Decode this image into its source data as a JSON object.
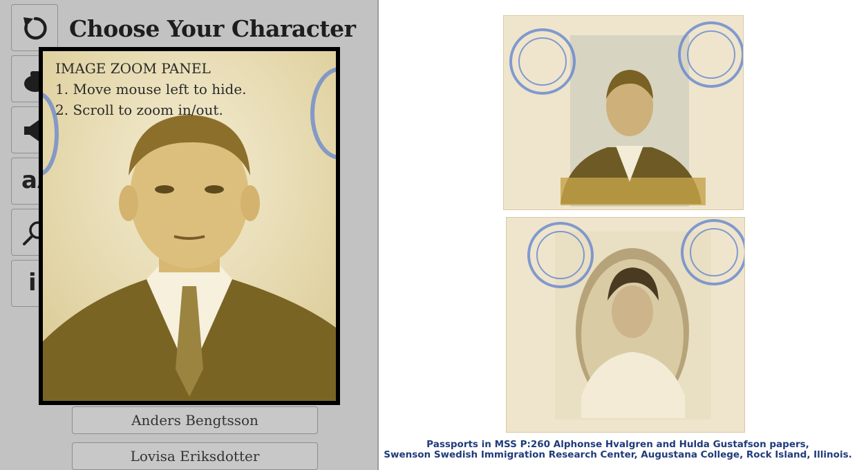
{
  "header": {
    "title": "Choose Your Character"
  },
  "toolbar": {
    "buttons": [
      {
        "name": "restart",
        "icon": "restart-icon"
      },
      {
        "name": "inventory",
        "icon": "bag-icon"
      },
      {
        "name": "sound",
        "icon": "speaker-icon"
      },
      {
        "name": "text-size",
        "icon": "text-size-icon",
        "glyph": "aA"
      },
      {
        "name": "zoom",
        "icon": "magnifier-icon"
      },
      {
        "name": "info",
        "icon": "info-icon",
        "glyph": "i"
      }
    ]
  },
  "zoom_panel": {
    "title": "IMAGE ZOOM PANEL",
    "line1": "1. Move mouse left to hide.",
    "line2": "2. Scroll to zoom in/out."
  },
  "characters": [
    {
      "label": "Anders Bengtsson"
    },
    {
      "label": "Lovisa Eriksdotter"
    }
  ],
  "document": {
    "caption_line1": "Passports in MSS P:260 Alphonse Hvalgren and Hulda Gustafson papers,",
    "caption_line2": "Swenson Swedish Immigration Research Center,  Augustana College, Rock Island, Illinois."
  },
  "colors": {
    "panel_bg": "#c2c2c2",
    "stamp_blue": "#5b7fd0",
    "caption_blue": "#1f3b7a",
    "sepia": "#b89a45"
  }
}
